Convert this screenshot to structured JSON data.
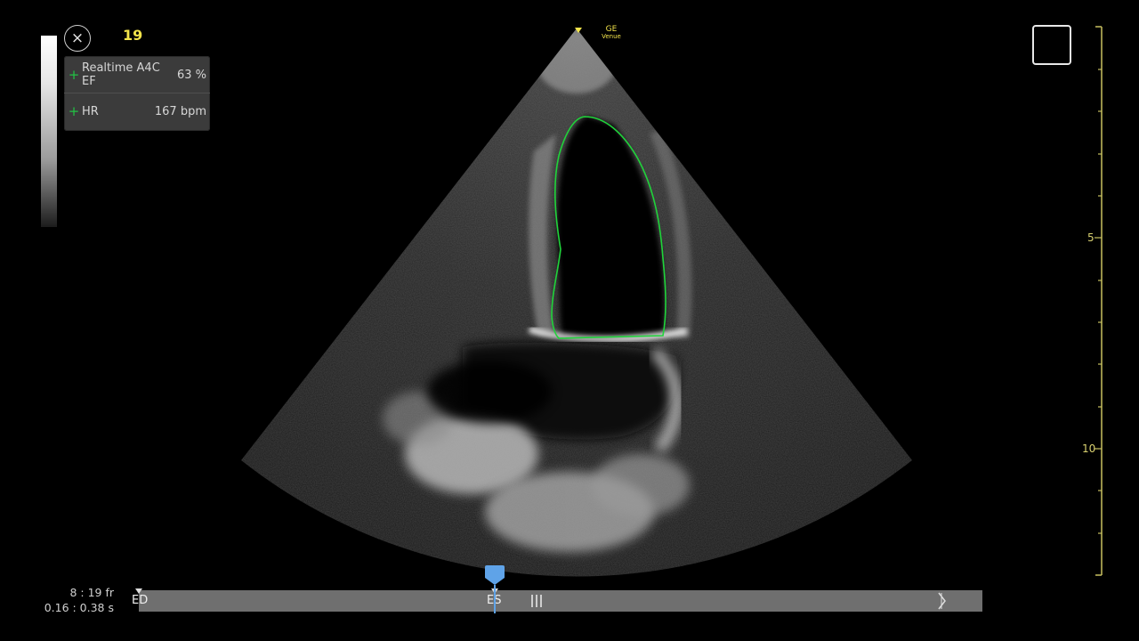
{
  "header": {
    "frame_number": "19",
    "close_icon": "×",
    "vendor_line1": "GE",
    "vendor_line2": "Venue"
  },
  "measurements": [
    {
      "icon": "+",
      "name": "Realtime A4C EF",
      "value": "63 %"
    },
    {
      "icon": "+",
      "name": "HR",
      "value": "167 bpm"
    }
  ],
  "depth_scale": {
    "labels": [
      "5",
      "10"
    ],
    "color": "#d8d070"
  },
  "playback": {
    "frame_ratio": "8 : 19 fr",
    "time_ratio": "0.16 : 0.38 s",
    "ed_label": "ED",
    "es_label": "ES",
    "position_fraction": 0.421
  },
  "colors": {
    "tracing": "#1fd43a",
    "accent_yellow": "#f2e34a",
    "playhead": "#5fa3e8",
    "measure_plus": "#22c244"
  }
}
